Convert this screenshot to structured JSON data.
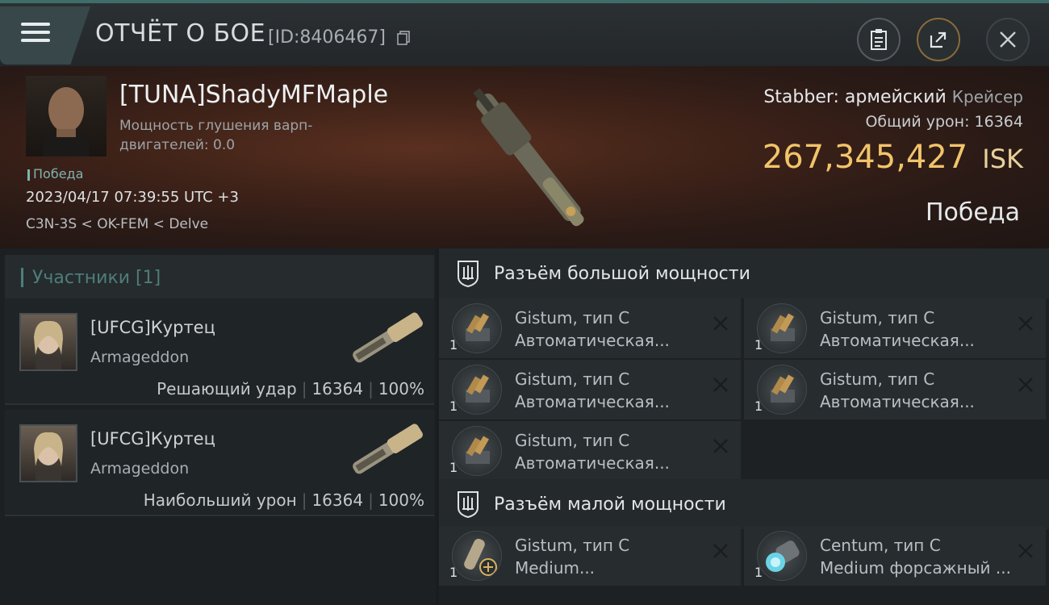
{
  "header": {
    "title": "ОТЧЁТ О БОЕ",
    "report_id": "[ID:8406467]"
  },
  "hero": {
    "pilot_name": "[TUNA]ShadyMFMaple",
    "warp_jam_label": "Мощность глушения варп-двигателей: 0.0",
    "victory_tag": "Победа",
    "datetime": "2023/04/17 07:39:55 UTC +3",
    "location": "C3N-3S < OK-FEM < Delve",
    "ship_name": "Stabber: армейский",
    "ship_class": "Крейсер",
    "damage_label": "Общий урон:",
    "damage_value": "16364",
    "isk_value": "267,345,427",
    "isk_unit": "ISK",
    "result": "Победа"
  },
  "participants": {
    "header": "Участники [1]",
    "items": [
      {
        "name": "[UFCG]Куртец",
        "ship": "Armageddon",
        "role": "Решающий удар",
        "damage": "16364",
        "percent": "100%"
      },
      {
        "name": "[UFCG]Куртец",
        "ship": "Armageddon",
        "role": "Наибольший урон",
        "damage": "16364",
        "percent": "100%"
      }
    ]
  },
  "high_slots": {
    "header": "Разъём большой мощности",
    "items": [
      {
        "qty": "1",
        "line1": "Gistum, тип C",
        "line2": "Автоматическая..."
      },
      {
        "qty": "1",
        "line1": "Gistum, тип C",
        "line2": "Автоматическая..."
      },
      {
        "qty": "1",
        "line1": "Gistum, тип C",
        "line2": "Автоматическая..."
      },
      {
        "qty": "1",
        "line1": "Gistum, тип C",
        "line2": "Автоматическая..."
      },
      {
        "qty": "1",
        "line1": "Gistum, тип C",
        "line2": "Автоматическая..."
      }
    ]
  },
  "low_slots": {
    "header": "Разъём малой мощности",
    "items": [
      {
        "qty": "1",
        "line1": "Gistum, тип C",
        "line2": "Medium..."
      },
      {
        "qty": "1",
        "line1": "Centum, тип C",
        "line2": "Medium форсажный ..."
      }
    ]
  },
  "icons": {
    "menu": "menu-icon",
    "copy": "copy-icon",
    "clipboard": "clipboard-icon",
    "share": "share-icon",
    "close": "close-icon",
    "remove": "remove-x-icon",
    "slot_section": "high-power-slot-icon"
  },
  "colors": {
    "accent": "#4e7d7a",
    "isk": "#f1c46a"
  }
}
